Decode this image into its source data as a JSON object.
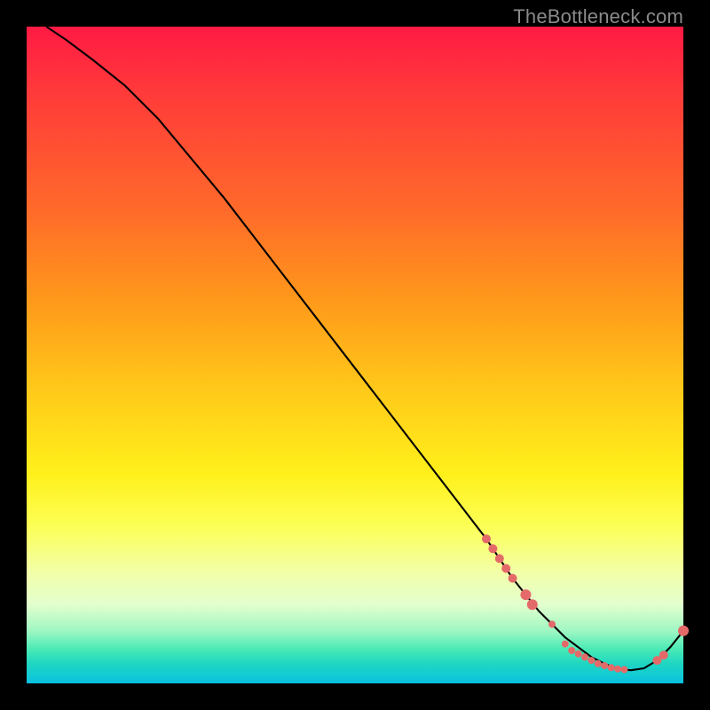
{
  "watermark": "TheBottleneck.com",
  "colors": {
    "dot": "#e46a6a",
    "line": "#000000",
    "background": "#000000"
  },
  "chart_data": {
    "type": "line",
    "title": "",
    "xlabel": "",
    "ylabel": "",
    "xlim": [
      0,
      100
    ],
    "ylim": [
      0,
      100
    ],
    "grid": false,
    "legend": false,
    "series": [
      {
        "name": "bottleneck-curve",
        "x": [
          3,
          6,
          10,
          15,
          20,
          25,
          30,
          35,
          40,
          45,
          50,
          55,
          60,
          65,
          70,
          72,
          74,
          76,
          78,
          80,
          82,
          84,
          86,
          88,
          90,
          92,
          94,
          96,
          98,
          100
        ],
        "y": [
          100,
          98,
          95,
          91,
          86,
          80,
          74,
          67.5,
          61,
          54.5,
          48,
          41.5,
          35,
          28.5,
          22,
          19,
          16,
          13.5,
          11,
          9,
          7,
          5.5,
          4,
          3,
          2.2,
          2,
          2.3,
          3.5,
          5.5,
          8
        ]
      }
    ],
    "points": [
      {
        "x": 70,
        "y": 22,
        "r": 5
      },
      {
        "x": 71,
        "y": 20.5,
        "r": 5
      },
      {
        "x": 72,
        "y": 19,
        "r": 5
      },
      {
        "x": 73,
        "y": 17.5,
        "r": 5
      },
      {
        "x": 74,
        "y": 16,
        "r": 5
      },
      {
        "x": 76,
        "y": 13.5,
        "r": 6
      },
      {
        "x": 77,
        "y": 12,
        "r": 6
      },
      {
        "x": 80,
        "y": 9,
        "r": 4
      },
      {
        "x": 82,
        "y": 6,
        "r": 4
      },
      {
        "x": 83,
        "y": 5,
        "r": 4
      },
      {
        "x": 84,
        "y": 4.5,
        "r": 4
      },
      {
        "x": 85,
        "y": 4,
        "r": 4
      },
      {
        "x": 86,
        "y": 3.5,
        "r": 4
      },
      {
        "x": 87,
        "y": 3,
        "r": 4
      },
      {
        "x": 88,
        "y": 2.7,
        "r": 4
      },
      {
        "x": 89,
        "y": 2.4,
        "r": 4
      },
      {
        "x": 90,
        "y": 2.2,
        "r": 4
      },
      {
        "x": 91,
        "y": 2.1,
        "r": 4
      },
      {
        "x": 96,
        "y": 3.5,
        "r": 5
      },
      {
        "x": 97,
        "y": 4.3,
        "r": 5
      },
      {
        "x": 100,
        "y": 8,
        "r": 6
      }
    ]
  }
}
